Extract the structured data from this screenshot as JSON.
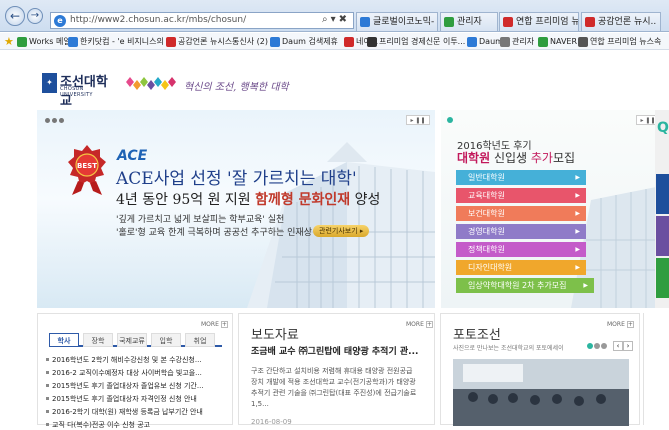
{
  "browser": {
    "url": "http://www2.chosun.ac.kr/mbs/chosun/",
    "tabs": [
      {
        "label": "글로벌이코노믹-",
        "color": "#2d7ad6"
      },
      {
        "label": "관리자",
        "color": "#2f9d3f"
      },
      {
        "label": "연합 프리미엄 뉴스",
        "color": "#d02a2a"
      },
      {
        "label": "공감언론 뉴시..",
        "color": "#d02a2a"
      }
    ],
    "favorites": [
      {
        "label": "Works 메일",
        "color": "#2f9d3f"
      },
      {
        "label": "한키닷컴 - 'e 비지니스의 ...",
        "color": "#2d7ad6"
      },
      {
        "label": "공감언론 뉴시스통신사 (2)",
        "color": "#d02a2a"
      },
      {
        "label": "Daum 검색제휴",
        "color": "#2d7ad6"
      },
      {
        "label": "네이트",
        "color": "#d02a2a"
      },
      {
        "label": "프리미엄 경제신문 이투...",
        "color": "#333333"
      },
      {
        "label": "Daum",
        "color": "#2d7ad6"
      },
      {
        "label": "관리자",
        "color": "#777777"
      },
      {
        "label": "NAVER",
        "color": "#2f9d3f"
      },
      {
        "label": "연합 프리미엄 뉴스속",
        "color": "#555555"
      }
    ]
  },
  "header": {
    "logo_kr": "조선대학교",
    "logo_en": "CHOSUN UNIVERSITY",
    "slogan": "혁신의 조선, 행복한 대학",
    "diamond_colors": [
      "#e64a8c",
      "#f29a2e",
      "#8ec63f",
      "#6b4fa0",
      "#23a9c9",
      "#f5c518",
      "#d6336c"
    ]
  },
  "banner": {
    "badge": "BEST",
    "ace": "ACE",
    "line1": "ACE사업 선정 '잘 가르치는 대학'",
    "line2_a": "4년 동안 95억 원 지원 ",
    "line2_b": "함께형 문화인재",
    "line2_c": " 양성",
    "line3": "'깊게 가르치고 넓게 보살피는 학부교육' 실천",
    "line4": "'홀로'형 교육 한계 극복하며 공공선 추구하는 인재상",
    "more_label": "관련기사보기 ▸",
    "play_pause": "▸ ❚❚"
  },
  "admission": {
    "year": "2016학년도 후기",
    "title_a": "대학원",
    "title_b": " 신입생 ",
    "title_c": "추가",
    "title_d": "모집",
    "menu": [
      {
        "label": "일반대학원",
        "color": "#45b0d8"
      },
      {
        "label": "교육대학원",
        "color": "#e8556b"
      },
      {
        "label": "보건대학원",
        "color": "#f07b5a"
      },
      {
        "label": "경영대학원",
        "color": "#8f7bc8"
      },
      {
        "label": "정책대학원",
        "color": "#c45bc9"
      },
      {
        "label": "디자인대학원",
        "color": "#f0a72c"
      },
      {
        "label": "임상약학대학원 2차 추가모집",
        "color": "#7dc04a"
      }
    ]
  },
  "notice": {
    "more": "MORE",
    "tabs": [
      "학사",
      "장학",
      "국제교류",
      "입학",
      "취업"
    ],
    "items": [
      "2016학년도 2학기 해비수강신청 및 본 수강신청...",
      "2016-2 교직이수예정자 대상 사이버학습 빛고을...",
      "2015학년도 후기 졸업대상자 졸업유보 신청 기간...",
      "2015학년도 후기 졸업대상자 자격인정 신청 안내",
      "2016-2학기 대학(원) 재학생 등록금 납부기간 안내",
      "교직 다(복수)전공 이수 신청 공고"
    ]
  },
  "press": {
    "title": "보도자료",
    "more": "MORE",
    "headline": "조금배 교수 ㈜그린탑에 태양광 추적기 관...",
    "body": "구조 간단하고 설치비용 저렴해 휴대용 태양광 전원공급 장치 개발에 적용 조선대학교 교수(전기공학과)가 태양광 추적기 관련 기술을 ㈜그린탑(대표 주진성)에 전급기술료 1,5...",
    "date": "2016-08-09"
  },
  "photo": {
    "title": "포토조선",
    "more": "MORE",
    "subtitle": "사진으로 만나보는 조선대학교의 포토에세이",
    "prev": "‹",
    "next": "›"
  }
}
